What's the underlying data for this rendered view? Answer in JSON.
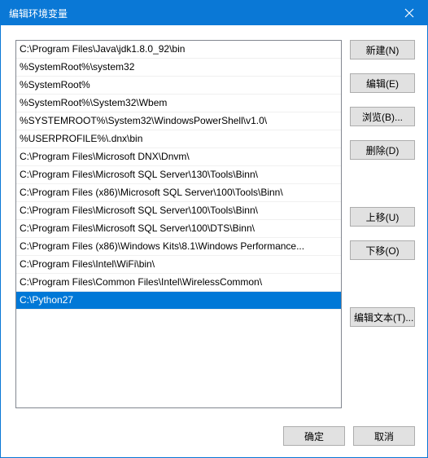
{
  "title": "编辑环境变量",
  "list": {
    "items": [
      "C:\\Program Files\\Java\\jdk1.8.0_92\\bin",
      "%SystemRoot%\\system32",
      "%SystemRoot%",
      "%SystemRoot%\\System32\\Wbem",
      "%SYSTEMROOT%\\System32\\WindowsPowerShell\\v1.0\\",
      "%USERPROFILE%\\.dnx\\bin",
      "C:\\Program Files\\Microsoft DNX\\Dnvm\\",
      "C:\\Program Files\\Microsoft SQL Server\\130\\Tools\\Binn\\",
      "C:\\Program Files (x86)\\Microsoft SQL Server\\100\\Tools\\Binn\\",
      "C:\\Program Files\\Microsoft SQL Server\\100\\Tools\\Binn\\",
      "C:\\Program Files\\Microsoft SQL Server\\100\\DTS\\Binn\\",
      "C:\\Program Files (x86)\\Windows Kits\\8.1\\Windows Performance...",
      "C:\\Program Files\\Intel\\WiFi\\bin\\",
      "C:\\Program Files\\Common Files\\Intel\\WirelessCommon\\",
      "C:\\Python27"
    ],
    "selected_index": 14
  },
  "buttons": {
    "new": "新建(N)",
    "edit": "编辑(E)",
    "browse": "浏览(B)...",
    "delete": "删除(D)",
    "moveup": "上移(U)",
    "movedown": "下移(O)",
    "edittext": "编辑文本(T)...",
    "ok": "确定",
    "cancel": "取消"
  }
}
